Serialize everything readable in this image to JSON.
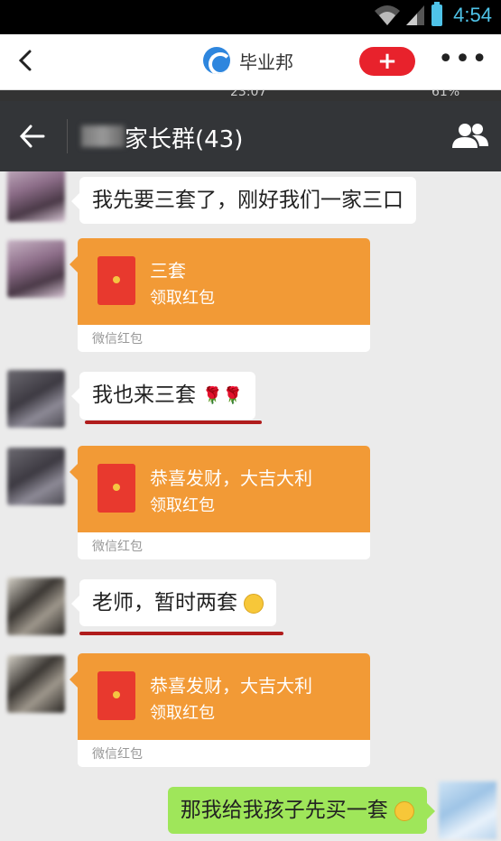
{
  "status_bar": {
    "time": "4:54"
  },
  "app_header": {
    "brand_name": "毕业邦",
    "add_label": "+",
    "more_label": "•••"
  },
  "inner_status": {
    "time": "23:07",
    "battery": "61%"
  },
  "chat": {
    "title": "家长群(43)",
    "messages": [
      {
        "type": "text",
        "text": "我先要三套了，刚好我们一家三口"
      },
      {
        "type": "redpacket",
        "title": "三套",
        "action": "领取红包",
        "label": "微信红包"
      },
      {
        "type": "text",
        "text": "我也来三套",
        "emoji": "🌹🌹"
      },
      {
        "type": "redpacket",
        "title": "恭喜发财，大吉大利",
        "action": "领取红包",
        "label": "微信红包"
      },
      {
        "type": "text",
        "text": "老师，暂时两套"
      },
      {
        "type": "redpacket",
        "title": "恭喜发财，大吉大利",
        "action": "领取红包",
        "label": "微信红包"
      },
      {
        "type": "text",
        "text": "那我给我孩子先买一套",
        "from": "me"
      }
    ]
  },
  "icons": [
    "back-icon",
    "members-icon",
    "wifi-icon",
    "signal-icon",
    "battery-icon",
    "redpacket-icon"
  ],
  "colors": {
    "redpacket_orange": "#f29a36",
    "my_bubble_green": "#9fe65a",
    "add_button_red": "#e8222c"
  }
}
